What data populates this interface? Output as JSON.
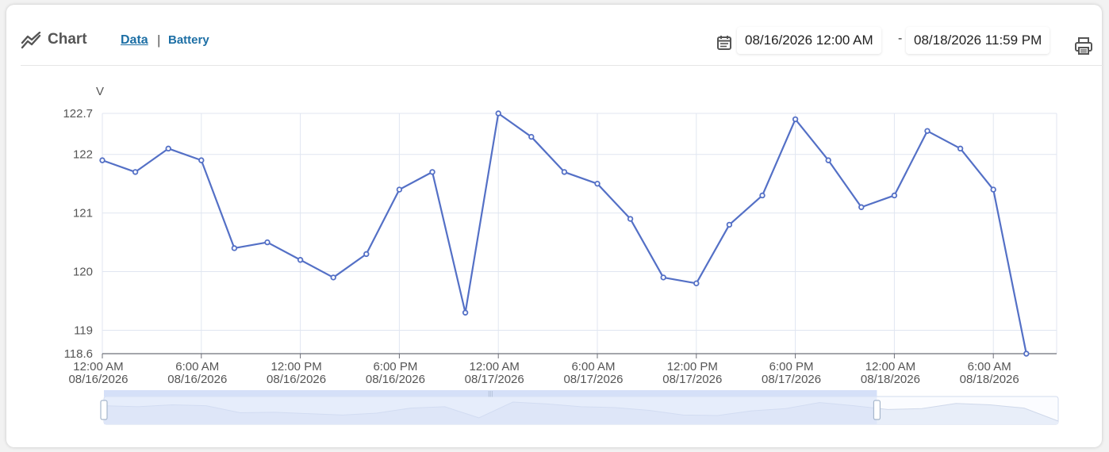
{
  "header": {
    "title": "Chart",
    "tabs": [
      {
        "label": "Data",
        "active": true
      },
      {
        "label": "Battery",
        "active": false
      }
    ],
    "tab_separator": "|",
    "date_start": "08/16/2026 12:00 AM",
    "date_separator": "-",
    "date_end": "08/18/2026 11:59 PM",
    "icons": [
      "chart-line-icon",
      "calendar-icon",
      "print-icon"
    ]
  },
  "colors": {
    "series": "#5470c6",
    "grid": "#e0e6f1",
    "zoom_fill": "#d5e0f8",
    "zoom_handle_border": "#a7b7cc"
  },
  "chart_data": {
    "type": "line",
    "ylabel": "V",
    "ylim": [
      118.6,
      122.7
    ],
    "y_ticks": [
      "122.7",
      "122",
      "121",
      "120",
      "119",
      "118.6"
    ],
    "x_ticks": [
      [
        "12:00 AM",
        "08/16/2026"
      ],
      [
        "6:00 AM",
        "08/16/2026"
      ],
      [
        "12:00 PM",
        "08/16/2026"
      ],
      [
        "6:00 PM",
        "08/16/2026"
      ],
      [
        "12:00 AM",
        "08/17/2026"
      ],
      [
        "6:00 AM",
        "08/17/2026"
      ],
      [
        "12:00 PM",
        "08/17/2026"
      ],
      [
        "6:00 PM",
        "08/17/2026"
      ],
      [
        "12:00 AM",
        "08/18/2026"
      ],
      [
        "6:00 AM",
        "08/18/2026"
      ]
    ],
    "series": [
      {
        "x": [
          "08/16/2026 12:00 AM",
          "08/16/2026 2:00 AM",
          "08/16/2026 4:00 AM",
          "08/16/2026 6:00 AM",
          "08/16/2026 8:00 AM",
          "08/16/2026 10:00 AM",
          "08/16/2026 12:00 PM",
          "08/16/2026 2:00 PM",
          "08/16/2026 4:00 PM",
          "08/16/2026 6:00 PM",
          "08/16/2026 8:00 PM",
          "08/16/2026 10:00 PM",
          "08/17/2026 12:00 AM",
          "08/17/2026 2:00 AM",
          "08/17/2026 4:00 AM",
          "08/17/2026 6:00 AM",
          "08/17/2026 8:00 AM",
          "08/17/2026 10:00 AM",
          "08/17/2026 12:00 PM",
          "08/17/2026 2:00 PM",
          "08/17/2026 4:00 PM",
          "08/17/2026 6:00 PM",
          "08/17/2026 8:00 PM",
          "08/17/2026 10:00 PM",
          "08/18/2026 12:00 AM",
          "08/18/2026 2:00 AM",
          "08/18/2026 4:00 AM",
          "08/18/2026 6:00 AM",
          "08/18/2026 8:00 AM"
        ],
        "values": [
          121.9,
          121.7,
          122.1,
          121.9,
          120.4,
          120.5,
          120.2,
          119.9,
          120.3,
          121.4,
          121.7,
          119.3,
          122.7,
          122.3,
          121.7,
          121.5,
          120.9,
          119.9,
          119.8,
          120.8,
          121.3,
          122.6,
          121.9,
          121.1,
          121.3,
          122.4,
          122.1,
          121.4,
          118.6
        ]
      }
    ],
    "grid": true,
    "zoom_slider": {
      "start": 0,
      "end": 0.81
    }
  }
}
